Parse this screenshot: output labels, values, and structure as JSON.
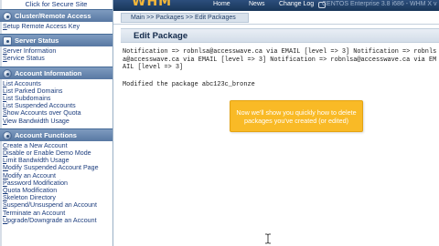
{
  "sidebar": {
    "top_link": "Click for Secure Site",
    "sections": [
      {
        "title": "Cluster/Remote Access",
        "items": [
          {
            "first": "S",
            "rest": "etup Remote Access Key"
          }
        ]
      },
      {
        "title": "Server Status",
        "items": [
          {
            "first": "S",
            "rest": "erver Information"
          },
          {
            "first": "S",
            "rest": "ervice Status"
          }
        ]
      },
      {
        "title": "Account Information",
        "items": [
          {
            "first": "L",
            "rest": "ist Accounts"
          },
          {
            "first": "L",
            "rest": "ist Parked Domains"
          },
          {
            "first": "L",
            "rest": "ist Subdomains"
          },
          {
            "first": "L",
            "rest": "ist Suspended Accounts"
          },
          {
            "first": "S",
            "rest": "how Accounts over Quota"
          },
          {
            "first": "V",
            "rest": "iew Bandwidth Usage"
          }
        ]
      },
      {
        "title": "Account Functions",
        "items": [
          {
            "first": "C",
            "rest": "reate a New Account"
          },
          {
            "first": "D",
            "rest": "isable or Enable Demo Mode"
          },
          {
            "first": "L",
            "rest": "imit Bandwidth Usage"
          },
          {
            "first": "M",
            "rest": "odify Suspended Account Page"
          },
          {
            "first": "M",
            "rest": "odify an Account"
          },
          {
            "first": "P",
            "rest": "assword Modification"
          },
          {
            "first": "Q",
            "rest": "uota Modification"
          },
          {
            "first": "S",
            "rest": "keleton Directory"
          },
          {
            "first": "S",
            "rest": "uspend/Unsuspend an Account"
          },
          {
            "first": "T",
            "rest": "erminate an Account"
          },
          {
            "first": "U",
            "rest": "pgrade/Downgrade an Account"
          }
        ]
      }
    ]
  },
  "topbar": {
    "logo": "WHM",
    "nav_home": "Home",
    "nav_news": "News",
    "nav_change": "Change Log",
    "version": "CENTOS Enterprise 3.8 i686 - WHM X v"
  },
  "breadcrumb": "Main >> Packages >> Edit Packages",
  "page_title": "Edit Package",
  "content": {
    "output": "Notification => robnlsa@accesswave.ca via EMAIL [level => 3] Notification => robnlsa@accesswave.ca via EMAIL [level => 3] Notification => robnlsa@accesswave.ca via EMAIL [level => 3]",
    "modified": "Modified the package abc123c_bronze"
  },
  "callout": {
    "text": "Now we'll show you quickly how to delete packages you've created (or edited)"
  },
  "colors": {
    "sidebar_header": "#5878a3",
    "topbar": "#183659",
    "callout": "#f9ba26",
    "logo": "#f3b63a"
  }
}
